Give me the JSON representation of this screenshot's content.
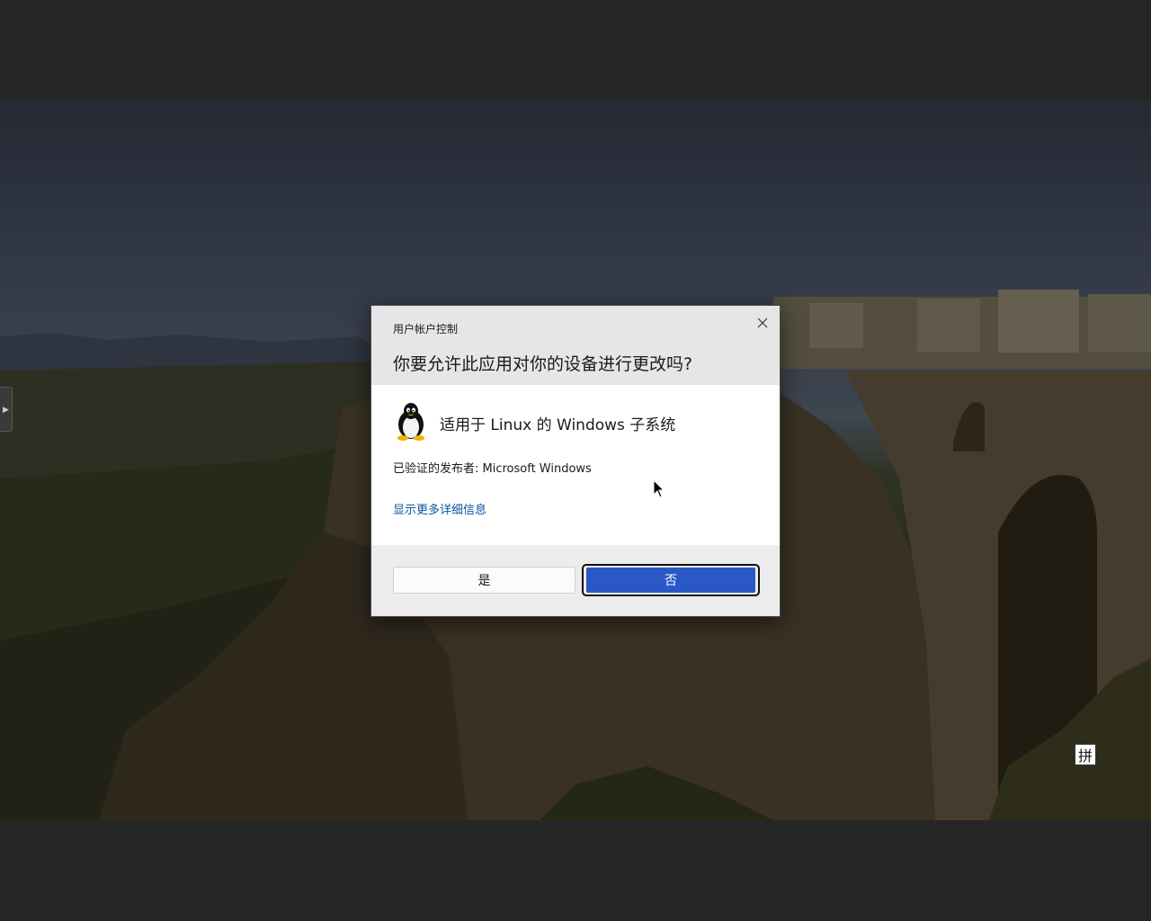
{
  "dialog": {
    "caption": "用户帐户控制",
    "question": "你要允许此应用对你的设备进行更改吗?",
    "app_name": "适用于 Linux 的 Windows 子系统",
    "publisher": "已验证的发布者: Microsoft Windows",
    "details_link": "显示更多详细信息",
    "yes_label": "是",
    "no_label": "否",
    "app_icon": "tux-penguin-icon",
    "close_icon": "close-icon"
  },
  "taskbar_ime": {
    "label": "拼"
  },
  "colors": {
    "primary_button": "#2a58c6",
    "link": "#0b55a3",
    "header_bg": "#e6e6e6"
  }
}
